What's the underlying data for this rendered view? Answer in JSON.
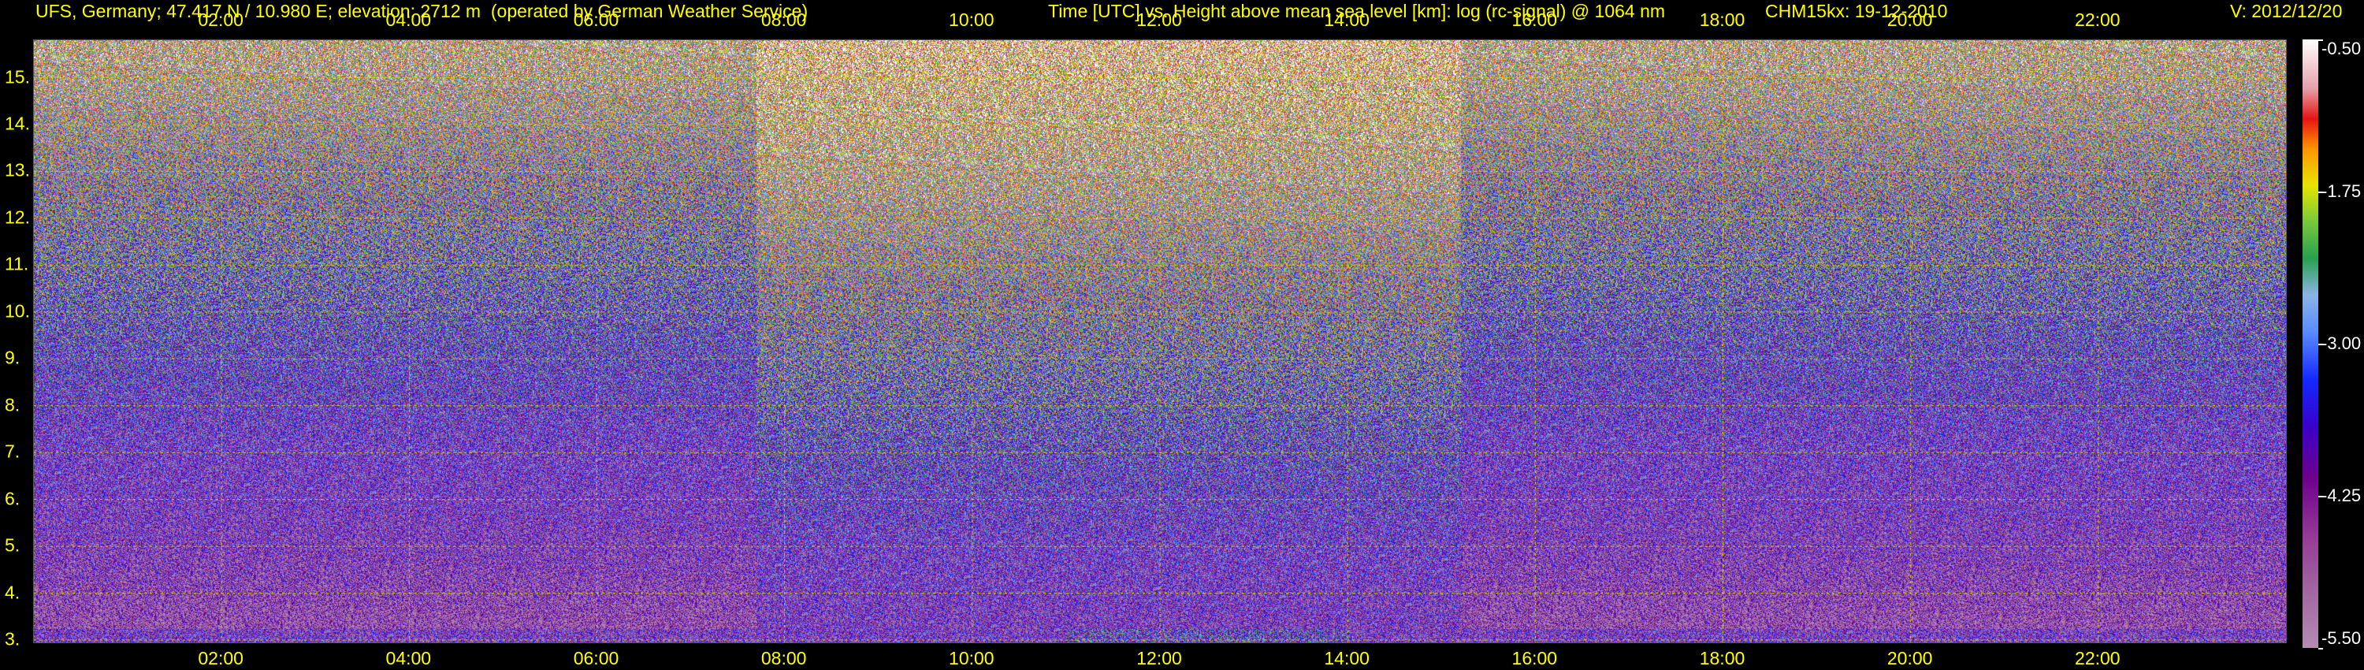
{
  "header": {
    "station": "UFS, Germany; 47.417 N / 10.980 E; elevation: 2712 m  (operated by German Weather Service)",
    "plot_desc": "Time [UTC] vs. Height above mean sea level [km]: log (rc-signal) @ 1064 nm",
    "instrument": "CHM15kx: 19-12-2010",
    "version": "V: 2012/12/20"
  },
  "chart_data": {
    "type": "heatmap",
    "xlabel": "Time [UTC]",
    "ylabel": "Height above mean sea level [km]",
    "x_range_hours": [
      0.0,
      24.0
    ],
    "y_range_km": [
      2.95,
      15.8
    ],
    "x_ticks": [
      "02:00",
      "04:00",
      "06:00",
      "08:00",
      "10:00",
      "12:00",
      "14:00",
      "16:00",
      "18:00",
      "20:00",
      "22:00"
    ],
    "x_tick_hours": [
      2,
      4,
      6,
      8,
      10,
      12,
      14,
      16,
      18,
      20,
      22
    ],
    "y_ticks": [
      "3.",
      "4.",
      "5.",
      "6.",
      "7.",
      "8.",
      "9.",
      "10.",
      "11.",
      "12.",
      "13.",
      "14.",
      "15."
    ],
    "y_tick_km": [
      3,
      4,
      5,
      6,
      7,
      8,
      9,
      10,
      11,
      12,
      13,
      14,
      15
    ],
    "grid": true,
    "colorbar": {
      "label_values": [
        "-0.50",
        "-1.75",
        "-3.00",
        "-4.25",
        "-5.50"
      ],
      "min": -5.5,
      "max": -0.5
    },
    "daytime_enhanced_noise_hours": [
      7.7,
      15.2
    ],
    "low_signal_layer_hours": [
      11.0,
      14.0
    ]
  }
}
